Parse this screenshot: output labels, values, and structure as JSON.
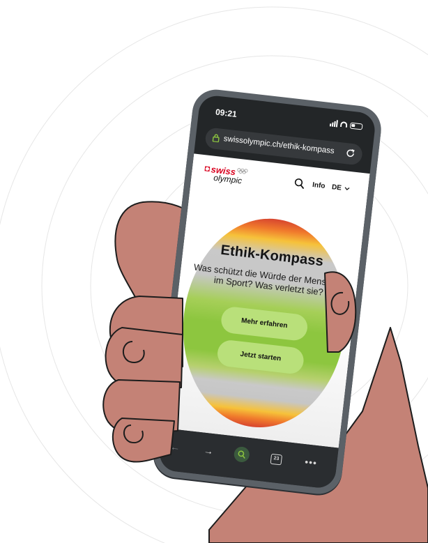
{
  "status_bar": {
    "time": "09:21"
  },
  "browser": {
    "url": "swissolympic.ch/ethik-kompass",
    "bottom_bar": {
      "tab_count": "23",
      "back_glyph": "←",
      "forward_glyph": "→",
      "more_glyph": "•••"
    }
  },
  "site": {
    "logo": {
      "swiss": "swiss",
      "olympic": "olympic"
    },
    "nav": {
      "info": "Info",
      "language": "DE"
    }
  },
  "hero": {
    "title": "Ethik-Kompass",
    "text": "Was schützt die Würde der Menschen im Sport? Was verletzt sie?",
    "buttons": {
      "more": "Mehr erfahren",
      "start": "Jetzt starten"
    }
  },
  "colors": {
    "skin": "#c48276",
    "phone_frame": "#5b6167",
    "brand_red": "#d9001e",
    "button_green": "#b9e07a",
    "compass_green": "#8dc63f",
    "compass_orange": "#f07a2c",
    "compass_red": "#d7452f"
  },
  "icons": [
    "lock-icon",
    "reload-icon",
    "search-icon",
    "chevron-down-icon",
    "back-icon",
    "forward-icon",
    "tabs-icon",
    "more-icon"
  ]
}
